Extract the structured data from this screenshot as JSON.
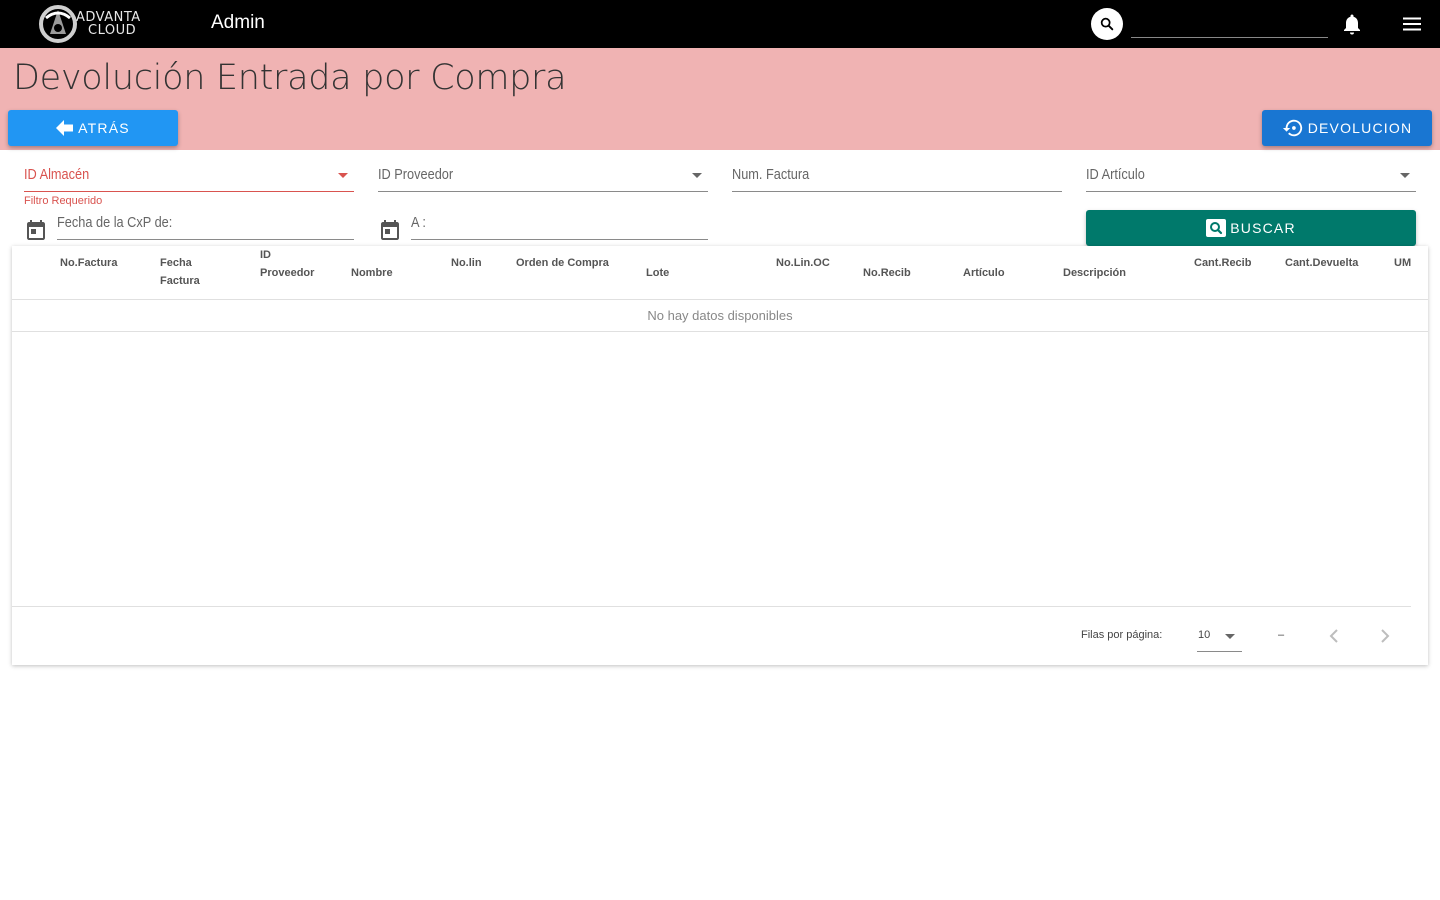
{
  "appbar": {
    "logo_line1": "ADVANTA",
    "logo_line2": "CLOUD",
    "title": "Admin",
    "search_placeholder": ""
  },
  "page": {
    "title": "Devolución Entrada por Compra",
    "back_label": "ATRÁS",
    "devolucion_label": "DEVOLUCION"
  },
  "filters": {
    "almacen_label": "ID Almacén",
    "almacen_error": "Filtro Requerido",
    "proveedor_label": "ID Proveedor",
    "factura_label": "Num. Factura",
    "articulo_label": "ID Artículo",
    "fecha_de_label": "Fecha de la CxP de:",
    "fecha_a_label": "A :",
    "buscar_label": "BUSCAR"
  },
  "table": {
    "columns": [
      "No.Factura",
      "Fecha Factura",
      "ID Proveedor",
      "Nombre",
      "No.lin",
      "Orden de Compra",
      "Lote",
      "No.Lin.OC",
      "No.Recib",
      "Artículo",
      "Descripción",
      "Cant.Recib",
      "Cant.Devuelta",
      "UM"
    ],
    "columns_display": {
      "c1": "No.Factura",
      "c2a": "Fecha",
      "c2b": "Factura",
      "c3a": "ID",
      "c3b": "Proveedor",
      "c4": "Nombre",
      "c5": "No.lin",
      "c6": "Orden de Compra",
      "c7": "Lote",
      "c8": "No.Lin.OC",
      "c9": "No.Recib",
      "c10": "Artículo",
      "c11": "Descripción",
      "c12": "Cant.Recib",
      "c13": "Cant.Devuelta",
      "c14": "UM"
    },
    "empty_text": "No hay datos disponibles",
    "rows_per_page_label": "Filas por página:",
    "rows_per_page_value": "10",
    "range_text": "–"
  },
  "colors": {
    "appbar": "#000000",
    "header": "#f0b3b3",
    "back_button": "#2196f3",
    "devolucion_button": "#1976d2",
    "buscar_button": "#00796b",
    "error": "#d9534f"
  },
  "icons": {
    "search": "search-icon",
    "bell": "bell-icon",
    "menu": "menu-icon",
    "back": "arrow-left-icon",
    "devolucion": "restore-icon",
    "calendar": "calendar-icon",
    "buscar": "search-box-icon",
    "prev": "chevron-left-icon",
    "next": "chevron-right-icon"
  }
}
